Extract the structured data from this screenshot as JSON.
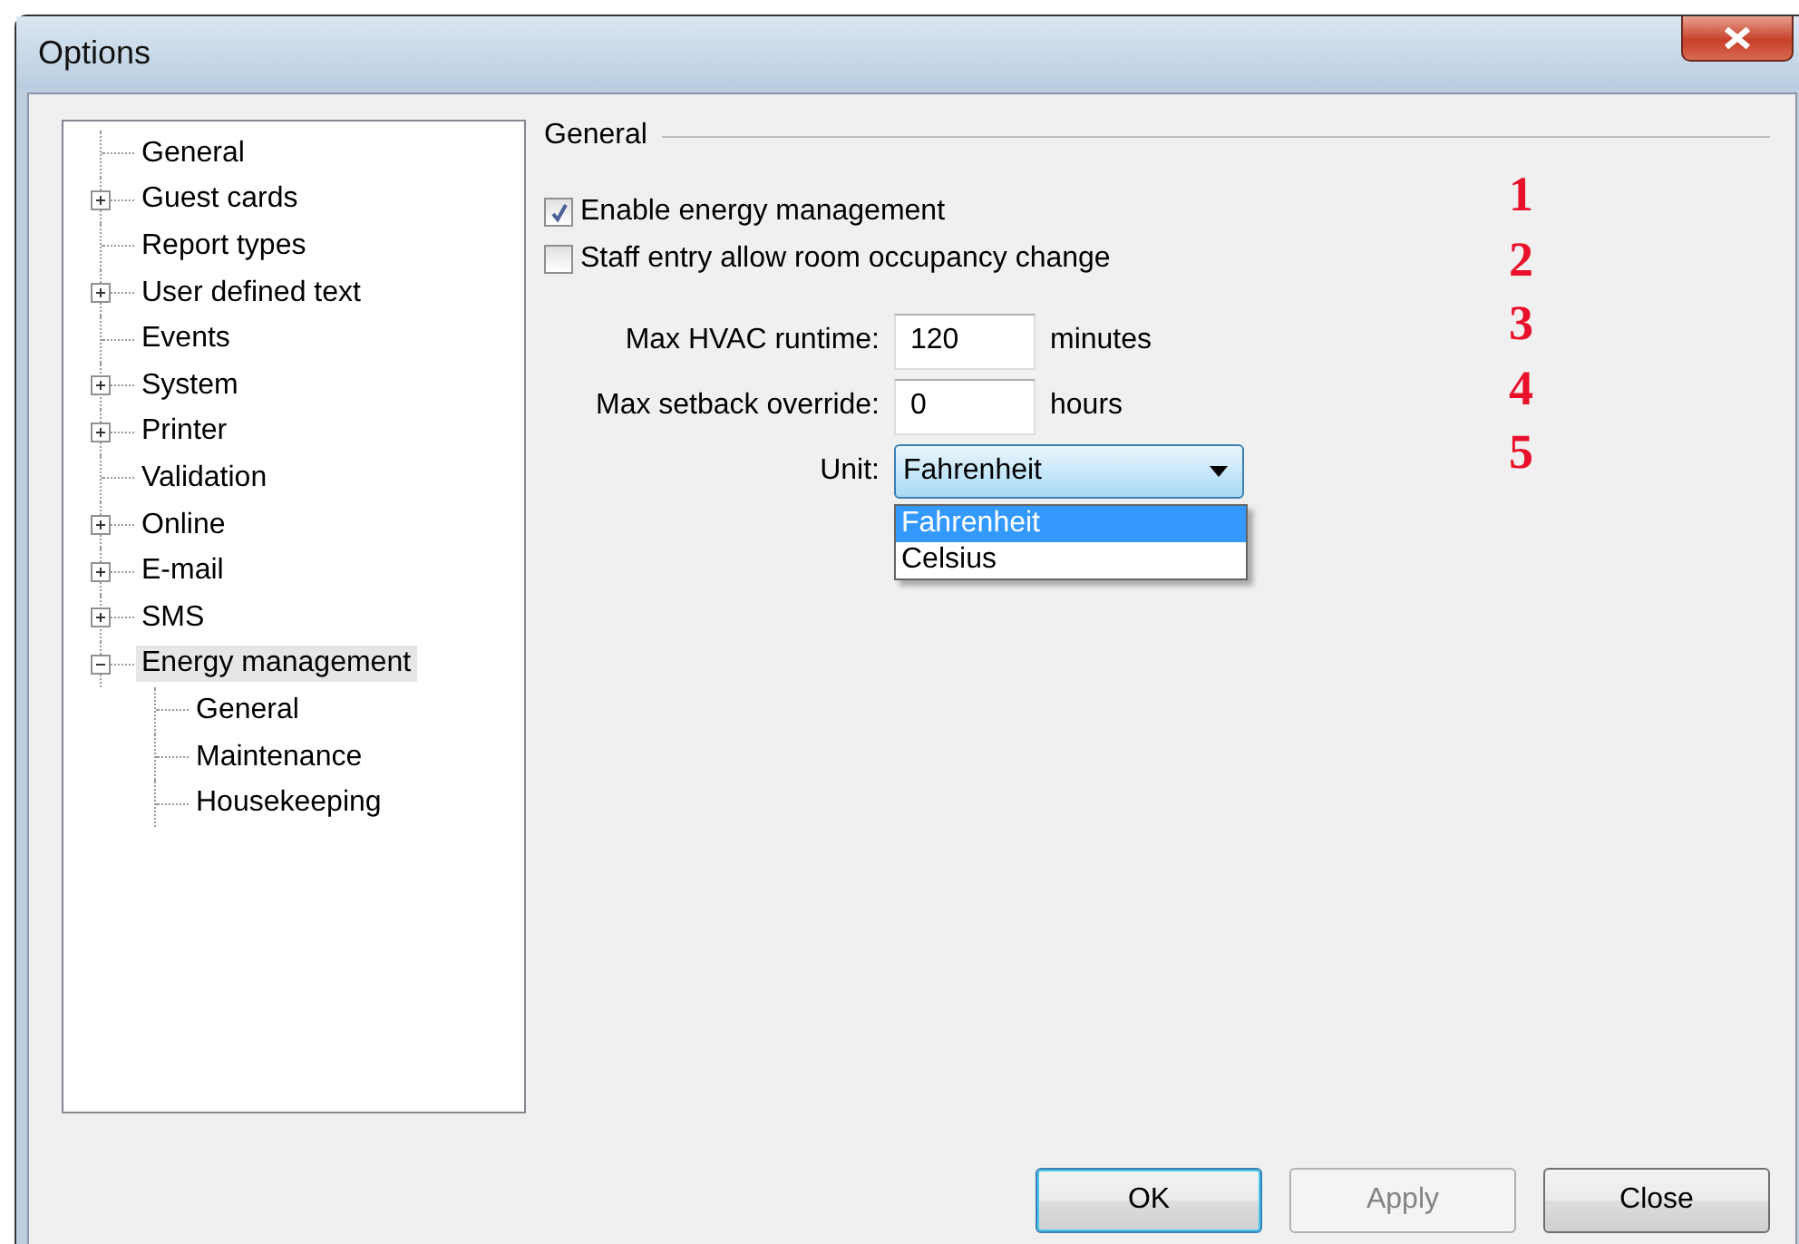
{
  "window": {
    "title": "Options"
  },
  "tree": [
    {
      "label": "General",
      "kind": "leaf",
      "selected": false
    },
    {
      "label": "Guest cards",
      "kind": "group",
      "expanded": false,
      "selected": false
    },
    {
      "label": "Report types",
      "kind": "leaf",
      "selected": false
    },
    {
      "label": "User defined text",
      "kind": "group",
      "expanded": false,
      "selected": false
    },
    {
      "label": "Events",
      "kind": "leaf",
      "selected": false
    },
    {
      "label": "System",
      "kind": "group",
      "expanded": false,
      "selected": false
    },
    {
      "label": "Printer",
      "kind": "group",
      "expanded": false,
      "selected": false
    },
    {
      "label": "Validation",
      "kind": "leaf",
      "selected": false
    },
    {
      "label": "Online",
      "kind": "group",
      "expanded": false,
      "selected": false
    },
    {
      "label": "E-mail",
      "kind": "group",
      "expanded": false,
      "selected": false
    },
    {
      "label": "SMS",
      "kind": "group",
      "expanded": false,
      "selected": false
    },
    {
      "label": "Energy management",
      "kind": "group",
      "expanded": true,
      "selected": true,
      "children": [
        {
          "label": "General",
          "kind": "leaf",
          "selected": false
        },
        {
          "label": "Maintenance",
          "kind": "leaf",
          "selected": false
        },
        {
          "label": "Housekeeping",
          "kind": "leaf",
          "selected": false
        }
      ]
    }
  ],
  "section_title": "General",
  "checkboxes": [
    {
      "label": "Enable energy management",
      "checked": true
    },
    {
      "label": "Staff entry allow room occupancy change",
      "checked": false
    }
  ],
  "fields": [
    {
      "label": "Max HVAC runtime:",
      "value": "120",
      "unit": "minutes"
    },
    {
      "label": "Max setback override:",
      "value": "0",
      "unit": "hours"
    }
  ],
  "unit_select": {
    "label": "Unit:",
    "value": "Fahrenheit",
    "options": [
      {
        "label": "Fahrenheit",
        "selected": true
      },
      {
        "label": "Celsius",
        "selected": false
      }
    ]
  },
  "annotations": [
    "1",
    "2",
    "3",
    "4",
    "5"
  ],
  "buttons": [
    {
      "label": "OK",
      "kind": "default",
      "disabled": false
    },
    {
      "label": "Apply",
      "kind": "normal",
      "disabled": true
    },
    {
      "label": "Close",
      "kind": "normal",
      "disabled": false
    }
  ]
}
